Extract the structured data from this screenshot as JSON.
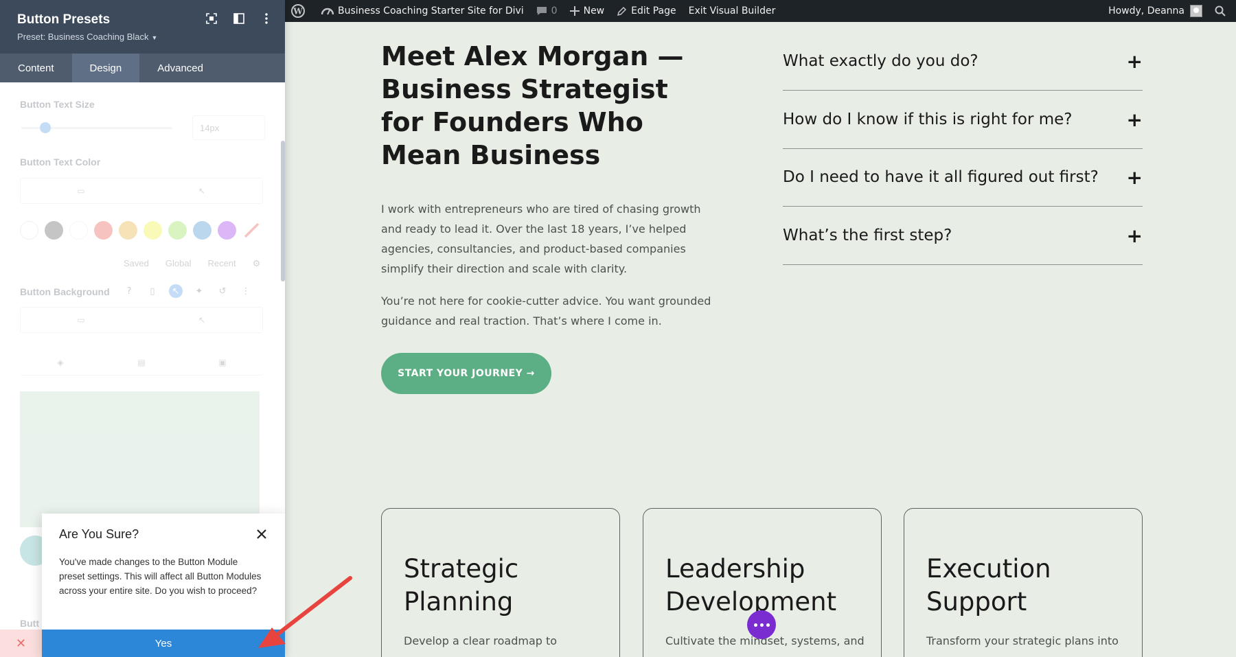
{
  "adminbar": {
    "wp_logo": "wordpress-icon",
    "site_name": "Business Coaching Starter Site for Divi",
    "comments_count": "0",
    "new_label": "New",
    "edit_page_label": "Edit Page",
    "exit_builder_label": "Exit Visual Builder",
    "howdy": "Howdy, Deanna"
  },
  "panel": {
    "title": "Button Presets",
    "preset": "Preset: Business Coaching Black",
    "tabs": [
      "Content",
      "Design",
      "Advanced"
    ],
    "active_tab": "Design",
    "fields": {
      "text_size_label": "Button Text Size",
      "text_size_value": "14px",
      "text_color_label": "Button Text Color",
      "palette_tabs": [
        "Saved",
        "Global",
        "Recent"
      ],
      "background_label": "Button Background",
      "bottom_label": "Butt"
    },
    "swatch_colors": [
      "#ffffff",
      "#333333",
      "#ffffff",
      "#e02b20",
      "#e09900",
      "#edf000",
      "#7cda24",
      "#0c71c3",
      "#8300e9"
    ]
  },
  "dialog": {
    "title": "Are You Sure?",
    "message": "You've made changes to the Button Module preset settings. This will affect all Button Modules across your entire site. Do you wish to proceed?",
    "yes_label": "Yes"
  },
  "hero": {
    "title": "Meet Alex Morgan — Business Strategist for Founders Who Mean Business",
    "paragraph1": "I work with entrepreneurs who are tired of chasing growth and ready to lead it. Over the last 18 years, I’ve helped agencies, consultancies, and product-based companies simplify their direction and scale with clarity.",
    "paragraph2": "You’re not here for cookie-cutter advice. You want grounded guidance and real traction. That’s where I come in.",
    "cta_label": "START YOUR JOURNEY →"
  },
  "faq": [
    {
      "question": "What exactly do you do?"
    },
    {
      "question": "How do I know if this is right for me?"
    },
    {
      "question": "Do I need to have it all figured out first?"
    },
    {
      "question": "What’s the first step?"
    }
  ],
  "cards": [
    {
      "title": "Strategic Planning",
      "text": "Develop a clear roadmap to"
    },
    {
      "title": "Leadership Development",
      "text": "Cultivate the mindset, systems, and"
    },
    {
      "title": "Execution Support",
      "text": "Transform your strategic plans into"
    }
  ],
  "colors": {
    "accent_green": "#5cae84",
    "dialog_blue": "#2d87d9",
    "fab_purple": "#7b2cd1",
    "panel_header": "#3c4a5c"
  }
}
